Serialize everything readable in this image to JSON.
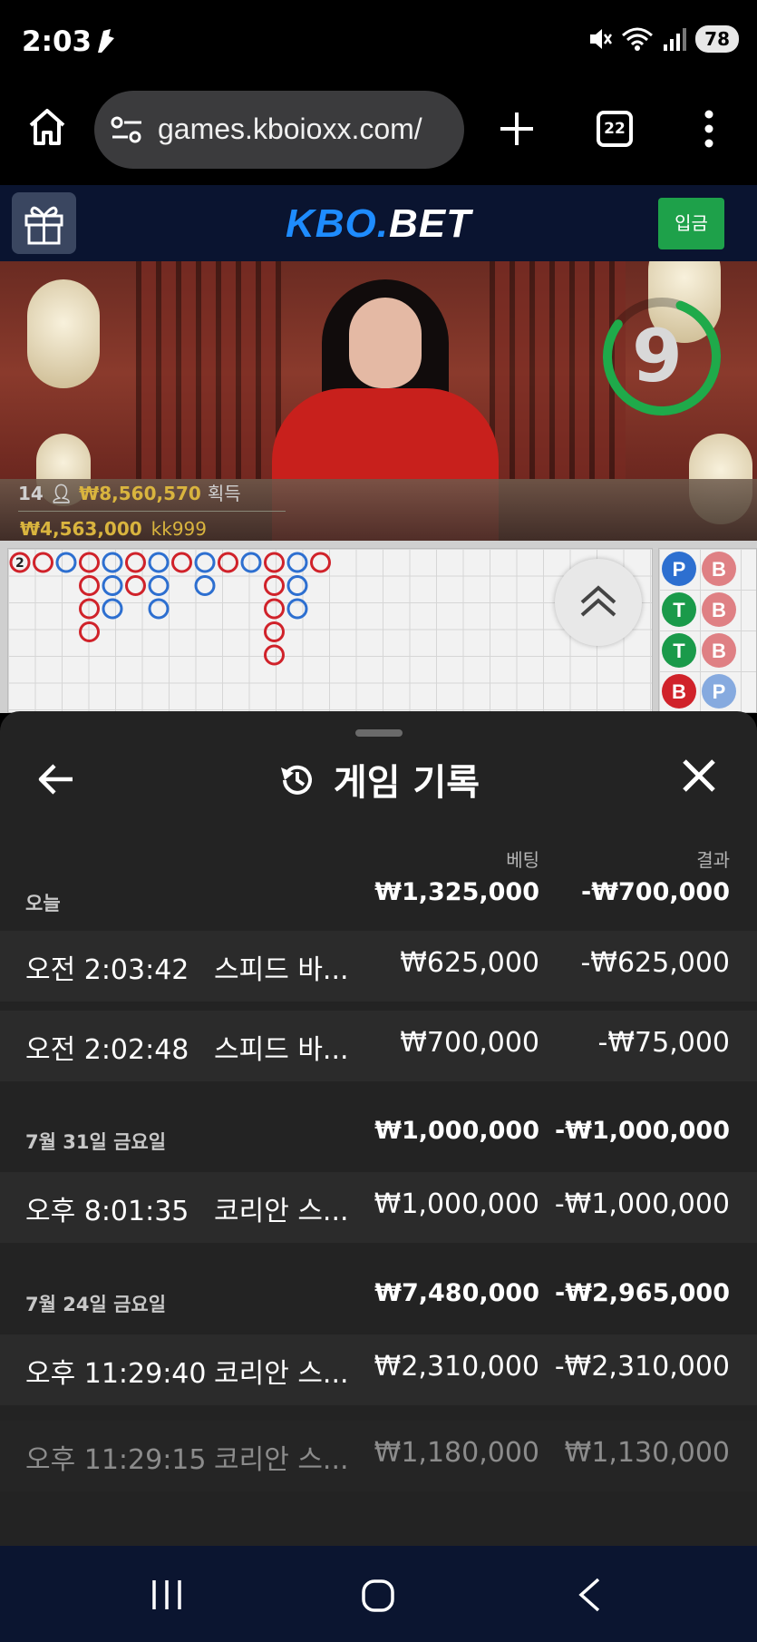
{
  "status_bar": {
    "time": "2:03",
    "battery": "78",
    "icons": [
      "mute-icon",
      "wifi-icon",
      "signal-icon"
    ]
  },
  "browser": {
    "url": "games.kboioxx.com/",
    "tab_count": "22",
    "icons": [
      "home-icon",
      "site-settings-icon",
      "new-tab-icon",
      "more-menu-icon"
    ]
  },
  "site": {
    "logo_part1": "KBO.",
    "logo_part2": "BET",
    "deposit_label": "입금",
    "brand_color": "#1e8cff",
    "deposit_color": "#1ea14a"
  },
  "video": {
    "countdown": "9",
    "player_count": "14",
    "win_amount": "₩8,560,570",
    "win_suffix": "획득",
    "top_bet_amount": "₩4,563,000",
    "top_bet_user": "kk999"
  },
  "roadmap": {
    "big_road_badge": "2",
    "bead_road": [
      [
        "P",
        "B"
      ],
      [
        "T",
        "B"
      ],
      [
        "T",
        "B"
      ],
      [
        "B",
        "P"
      ]
    ],
    "colors": {
      "player": "#2d6fd0",
      "banker": "#d0222a",
      "tie": "#1a9a4a"
    }
  },
  "history": {
    "title": "게임 기록",
    "col_bet": "베팅",
    "col_result": "결과",
    "groups": [
      {
        "label": "오늘",
        "bet": "₩1,325,000",
        "result": "-₩700,000",
        "entries": [
          {
            "time": "오전 2:03:42",
            "game": "스피드 바...",
            "bet": "₩625,000",
            "result": "-₩625,000"
          },
          {
            "time": "오전 2:02:48",
            "game": "스피드 바...",
            "bet": "₩700,000",
            "result": "-₩75,000"
          }
        ]
      },
      {
        "label": "7월 31일 금요일",
        "bet": "₩1,000,000",
        "result": "-₩1,000,000",
        "entries": [
          {
            "time": "오후 8:01:35",
            "game": "코리안 스...",
            "bet": "₩1,000,000",
            "result": "-₩1,000,000"
          }
        ]
      },
      {
        "label": "7월 24일 금요일",
        "bet": "₩7,480,000",
        "result": "-₩2,965,000",
        "entries": [
          {
            "time": "오후 11:29:40",
            "game": "코리안 스...",
            "bet": "₩2,310,000",
            "result": "-₩2,310,000"
          },
          {
            "time": "오후 11:29:15",
            "game": "코리안 스...",
            "bet": "₩1,180,000",
            "result": "₩1,130,000"
          }
        ]
      }
    ]
  },
  "nav": {
    "icons": [
      "recents-icon",
      "home-icon",
      "back-icon"
    ]
  }
}
